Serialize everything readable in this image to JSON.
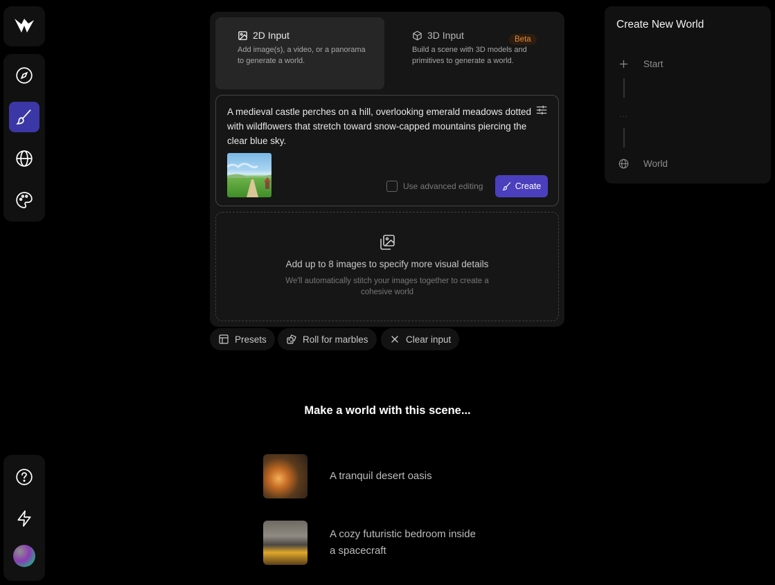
{
  "nav": {
    "items": [
      {
        "name": "explore",
        "icon": "compass-icon"
      },
      {
        "name": "create",
        "icon": "brush-icon",
        "active": true
      },
      {
        "name": "worlds",
        "icon": "globe-icon"
      },
      {
        "name": "styles",
        "icon": "palette-icon"
      }
    ],
    "bottom": [
      {
        "name": "help",
        "icon": "help-circle-icon"
      },
      {
        "name": "upgrade",
        "icon": "lightning-icon"
      },
      {
        "name": "profile",
        "icon": "avatar"
      }
    ]
  },
  "tabs": {
    "input_2d": {
      "title": "2D Input",
      "description": "Add image(s), a video, or a panorama to generate a world."
    },
    "input_3d": {
      "title": "3D Input",
      "badge": "Beta",
      "description": "Build a scene with 3D models and primitives to generate a world."
    }
  },
  "prompt": {
    "text": "A medieval castle perches on a hill, overlooking emerald meadows dotted with wildflowers that stretch toward snow-capped mountains piercing the clear blue sky.",
    "advanced_label": "Use advanced editing",
    "advanced_checked": false,
    "create_label": "Create"
  },
  "dropzone": {
    "title": "Add up to 8 images to specify more visual details",
    "subtitle": "We'll automatically stitch your images together to create a cohesive world"
  },
  "actions": {
    "presets": "Presets",
    "roll": "Roll for marbles",
    "clear": "Clear input"
  },
  "suggestions": {
    "heading": "Make a world with this scene...",
    "items": [
      {
        "label": "A tranquil desert oasis"
      },
      {
        "label": "A cozy futuristic bedroom inside a spacecraft"
      }
    ]
  },
  "side_panel": {
    "title": "Create New World",
    "steps": [
      {
        "label": "Start",
        "icon": "plus-icon"
      },
      {
        "label": "World",
        "icon": "globe-icon"
      }
    ],
    "ellipsis": "..."
  },
  "colors": {
    "accent": "#4b3fbd",
    "active_nav": "#3c37a6",
    "beta": "#e58b3a"
  }
}
